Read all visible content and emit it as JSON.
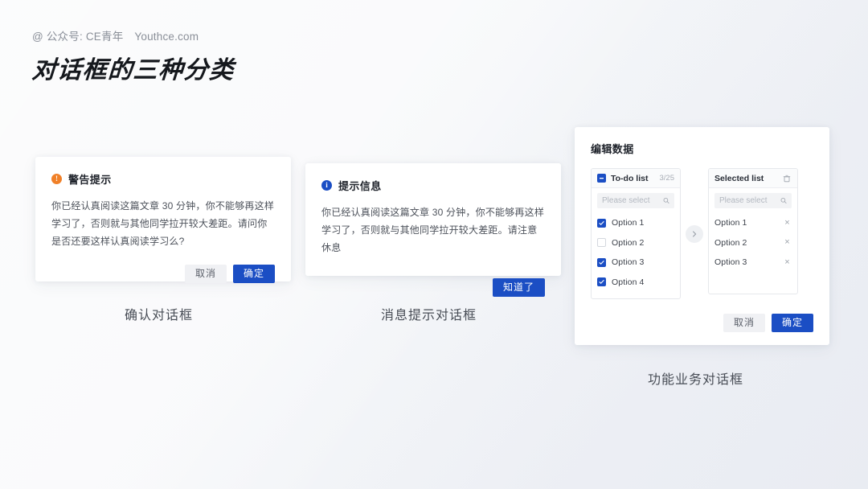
{
  "header": {
    "byline_at": "@",
    "byline_account": "公众号: CE青年",
    "byline_site": "Youthce.com",
    "title": "对话框的三种分类"
  },
  "colors": {
    "primary": "#1b4ec4",
    "warning": "#f08028",
    "info": "#1b4ec4",
    "text": "#1f232b",
    "muted": "#8a8f98",
    "card": "#ffffff",
    "page_bg": "#f4f6f9"
  },
  "dialogs": {
    "confirm": {
      "icon": "warning-circle-icon",
      "icon_glyph": "!",
      "title": "警告提示",
      "body": "你已经认真阅读这篇文章 30 分钟，你不能够再这样学习了，否则就与其他同学拉开较大差距。请问你是否还要这样认真阅读学习么?",
      "cancel_label": "取消",
      "confirm_label": "确定",
      "caption": "确认对话框"
    },
    "message": {
      "icon": "info-circle-icon",
      "icon_glyph": "i",
      "title": "提示信息",
      "body": "你已经认真阅读这篇文章 30 分钟，你不能够再这样学习了，否则就与其他同学拉开较大差距。请注意休息",
      "confirm_label": "知道了",
      "caption": "消息提示对话框"
    },
    "transfer": {
      "title": "编辑数据",
      "caption": "功能业务对话框",
      "cancel_label": "取消",
      "confirm_label": "确定",
      "arrow_icon": "chevron-right-icon",
      "source": {
        "header_label": "To-do list",
        "count": "3/25",
        "checkbox_state": "indeterminate",
        "search_placeholder": "Please select",
        "search_value": "",
        "search_icon": "search-icon",
        "items": [
          {
            "label": "Option 1",
            "checked": true
          },
          {
            "label": "Option 2",
            "checked": false
          },
          {
            "label": "Option 3",
            "checked": true
          },
          {
            "label": "Option 4",
            "checked": true
          }
        ]
      },
      "target": {
        "header_label": "Selected list",
        "clear_icon": "trash-icon",
        "search_placeholder": "Please select",
        "search_value": "",
        "search_icon": "search-icon",
        "items": [
          {
            "label": "Option 1",
            "remove_icon": "close-icon"
          },
          {
            "label": "Option 2",
            "remove_icon": "close-icon"
          },
          {
            "label": "Option 3",
            "remove_icon": "close-icon"
          }
        ]
      }
    }
  }
}
